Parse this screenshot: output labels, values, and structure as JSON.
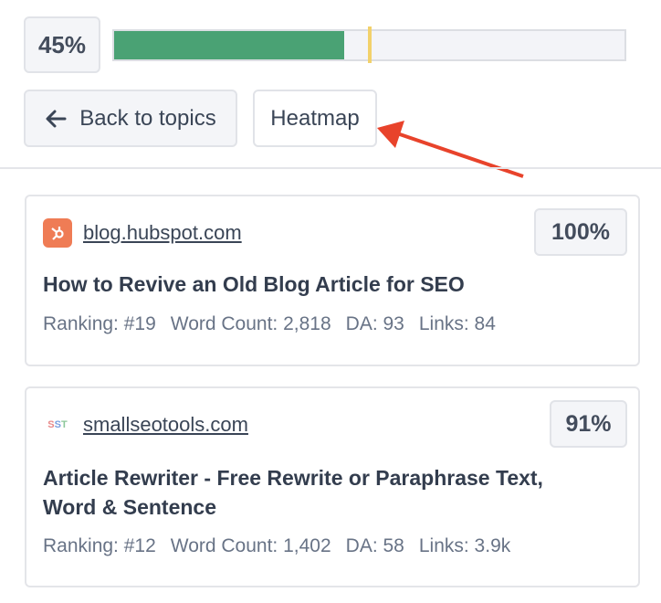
{
  "progress": {
    "label": "45%",
    "fill_percent": 45,
    "marker_percent": 50,
    "fill_color": "#4aa274",
    "marker_color": "#f2d16b"
  },
  "buttons": {
    "back_label": "Back to topics",
    "heatmap_label": "Heatmap"
  },
  "annotation": {
    "arrow_color": "#e8432b",
    "icon": "arrow-pointer"
  },
  "results": [
    {
      "site": "blog.hubspot.com",
      "favicon": "hubspot-icon",
      "score": "100%",
      "title": "How to Revive an Old Blog Article for SEO",
      "ranking": "Ranking: #19",
      "word_count": "Word Count: 2,818",
      "da": "DA: 93",
      "links": "Links: 84"
    },
    {
      "site": "smallseotools.com",
      "favicon": "sst-icon",
      "favicon_text": "SST",
      "score": "91%",
      "title": "Article Rewriter - Free Rewrite or Paraphrase Text, Word & Sentence",
      "ranking": "Ranking: #12",
      "word_count": "Word Count: 1,402",
      "da": "DA: 58",
      "links": "Links: 3.9k"
    }
  ]
}
